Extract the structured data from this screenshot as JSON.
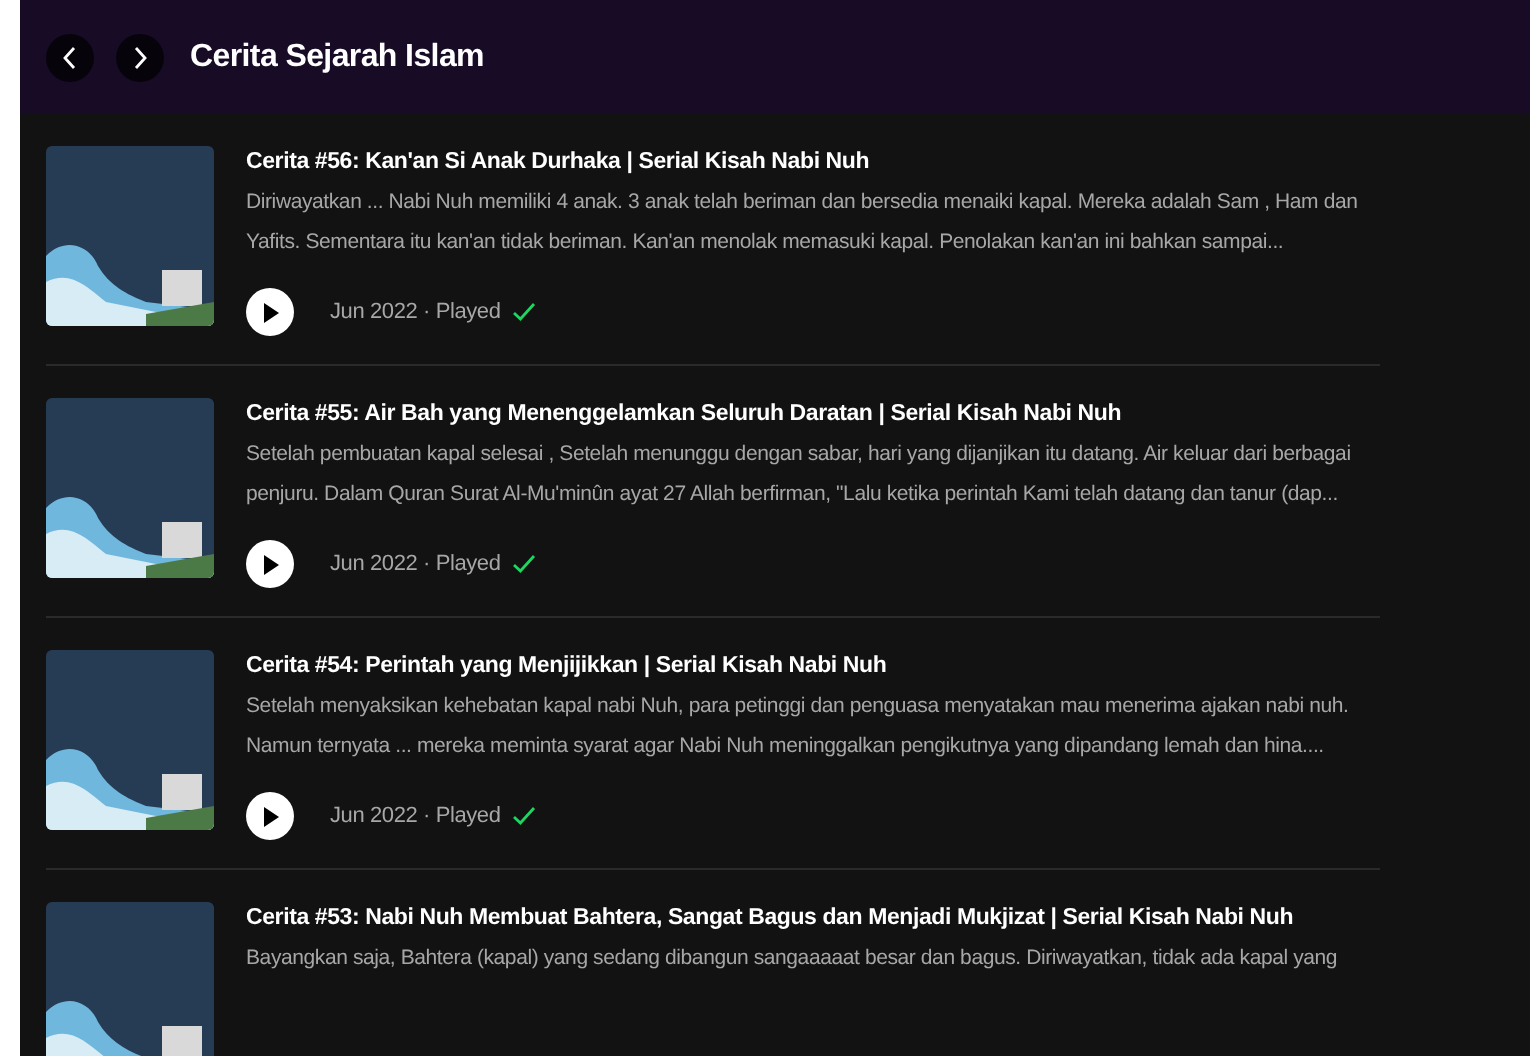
{
  "header": {
    "title": "Cerita Sejarah Islam"
  },
  "episodes": [
    {
      "title": "Cerita #56: Kan'an Si Anak Durhaka | Serial Kisah Nabi Nuh",
      "description": [
        "Diriwayatkan ... Nabi Nuh memiliki 4 anak. 3 anak telah beriman dan bersedia menaiki kapal. Mereka adalah Sam , Ham dan",
        "Yafits. Sementara itu kan'an tidak beriman. Kan'an menolak memasuki kapal. Penolakan kan'an ini bahkan sampai..."
      ],
      "meta": "Jun 2022 · Played",
      "played": true
    },
    {
      "title": "Cerita #55: Air Bah yang Menenggelamkan Seluruh Daratan | Serial Kisah Nabi Nuh",
      "description": [
        "Setelah pembuatan kapal selesai , Setelah menunggu dengan sabar, hari yang dijanjikan itu datang. Air keluar dari berbagai",
        "penjuru. Dalam Quran Surat Al-Mu'minûn ayat 27 Allah berfirman, \"Lalu ketika perintah Kami telah datang dan tanur (dap..."
      ],
      "meta": "Jun 2022 · Played",
      "played": true
    },
    {
      "title": "Cerita #54: Perintah yang Menjijikkan | Serial Kisah Nabi Nuh",
      "description": [
        "Setelah menyaksikan kehebatan kapal nabi Nuh, para petinggi dan penguasa menyatakan mau menerima ajakan nabi nuh.",
        "Namun ternyata ... mereka meminta syarat agar Nabi Nuh meninggalkan pengikutnya yang dipandang lemah dan hina...."
      ],
      "meta": "Jun 2022 · Played",
      "played": true
    },
    {
      "title": "Cerita #53: Nabi Nuh Membuat Bahtera, Sangat Bagus dan Menjadi Mukjizat | Serial Kisah Nabi Nuh",
      "description": [
        "Bayangkan saja, Bahtera (kapal) yang sedang dibangun sangaaaaat besar dan bagus. Diriwayatkan, tidak ada kapal yang"
      ]
    }
  ]
}
